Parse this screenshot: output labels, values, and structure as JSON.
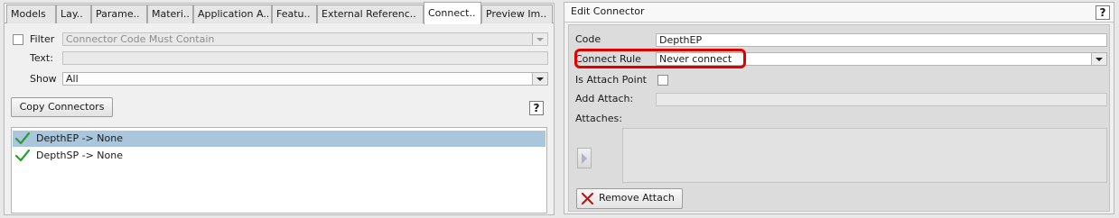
{
  "left_panel": {
    "tabs": [
      {
        "label": "Models",
        "active": false
      },
      {
        "label": "Lay..",
        "active": false
      },
      {
        "label": "Parame..",
        "active": false
      },
      {
        "label": "Materi..",
        "active": false
      },
      {
        "label": "Application A..",
        "active": false
      },
      {
        "label": "Featu..",
        "active": false
      },
      {
        "label": "External Referenc..",
        "active": false
      },
      {
        "label": "Connect..",
        "active": true
      },
      {
        "label": "Preview Im..",
        "active": false
      }
    ],
    "filter": {
      "label": "Filter",
      "checked": false,
      "placeholder": "Connector Code Must Contain"
    },
    "text": {
      "label": "Text:",
      "value": ""
    },
    "show": {
      "label": "Show",
      "value": "All"
    },
    "copy_button_label": "Copy Connectors",
    "help_label": "?",
    "connectors": [
      {
        "label": "DepthEP -> None",
        "selected": true,
        "icon": "checkmark-icon"
      },
      {
        "label": "DepthSP -> None",
        "selected": false,
        "icon": "checkmark-icon"
      }
    ]
  },
  "right_panel": {
    "title": "Edit Connector",
    "help_label": "?",
    "code": {
      "label": "Code",
      "value": "DepthEP"
    },
    "connect_rule": {
      "label": "Connect Rule",
      "value": "Never connect",
      "highlighted": true
    },
    "is_attach_point": {
      "label": "Is Attach Point",
      "checked": false
    },
    "add_attach": {
      "label": "Add Attach:",
      "value": ""
    },
    "attaches": {
      "label": "Attaches:"
    },
    "remove_attach_label": "Remove Attach"
  },
  "colors": {
    "selection": "#a9c6dc",
    "highlight_red": "#e00000",
    "checkmark_green": "#2e9e2e",
    "remove_red": "#d01010"
  }
}
